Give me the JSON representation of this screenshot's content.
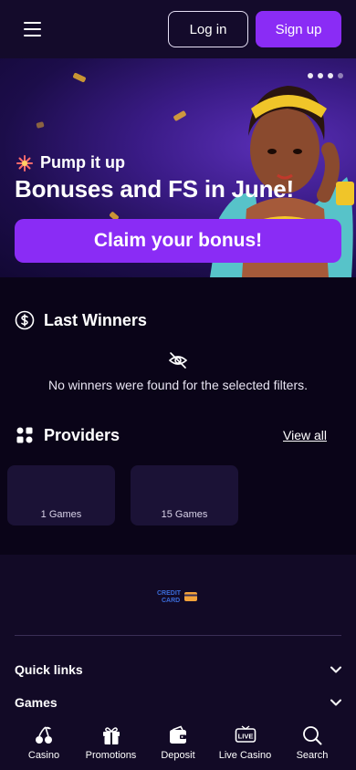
{
  "header": {
    "login_label": "Log in",
    "signup_label": "Sign up"
  },
  "banner": {
    "tag": "Pump it up",
    "title": "Bonuses and FS in June!",
    "cta_label": "Claim your bonus!",
    "slide_count": 4,
    "active_slide": 1
  },
  "winners": {
    "title": "Last Winners",
    "empty_message": "No winners were found for the selected filters."
  },
  "providers": {
    "title": "Providers",
    "view_all_label": "View all",
    "cards": [
      {
        "games": "1 Games"
      },
      {
        "games": "15 Games"
      }
    ]
  },
  "footer": {
    "logo_text_1": "CREDIT",
    "logo_text_2": "CARD",
    "accordions": [
      {
        "label": "Quick links"
      },
      {
        "label": "Games"
      }
    ]
  },
  "bottom_nav": [
    {
      "label": "Casino",
      "icon": "cherries-icon"
    },
    {
      "label": "Promotions",
      "icon": "gift-icon"
    },
    {
      "label": "Deposit",
      "icon": "wallet-icon"
    },
    {
      "label": "Live Casino",
      "icon": "live-tv-icon"
    },
    {
      "label": "Search",
      "icon": "search-icon"
    }
  ],
  "colors": {
    "accent": "#8a2cf5",
    "background": "#0a0418",
    "header_bg": "#140b2b",
    "card_bg": "#1b1236"
  }
}
